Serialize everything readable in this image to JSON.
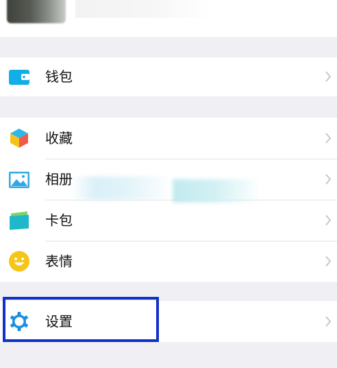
{
  "colors": {
    "page_bg": "#efeff4",
    "row_bg": "#ffffff",
    "highlight_border": "#1030c8",
    "wallet_icon": "#12aee8",
    "photos_icon": "#2fa9e6",
    "cards_icon": "#1fb8c8",
    "stickers_icon": "#f5c518",
    "settings_icon": "#1a8ee0"
  },
  "menu": {
    "wallet": {
      "label": "钱包",
      "icon": "wallet-icon"
    },
    "favorites": {
      "label": "收藏",
      "icon": "cube-icon"
    },
    "photos": {
      "label": "相册",
      "icon": "picture-icon"
    },
    "cards": {
      "label": "卡包",
      "icon": "card-icon"
    },
    "stickers": {
      "label": "表情",
      "icon": "smiley-icon"
    },
    "settings": {
      "label": "设置",
      "icon": "gear-icon"
    }
  }
}
